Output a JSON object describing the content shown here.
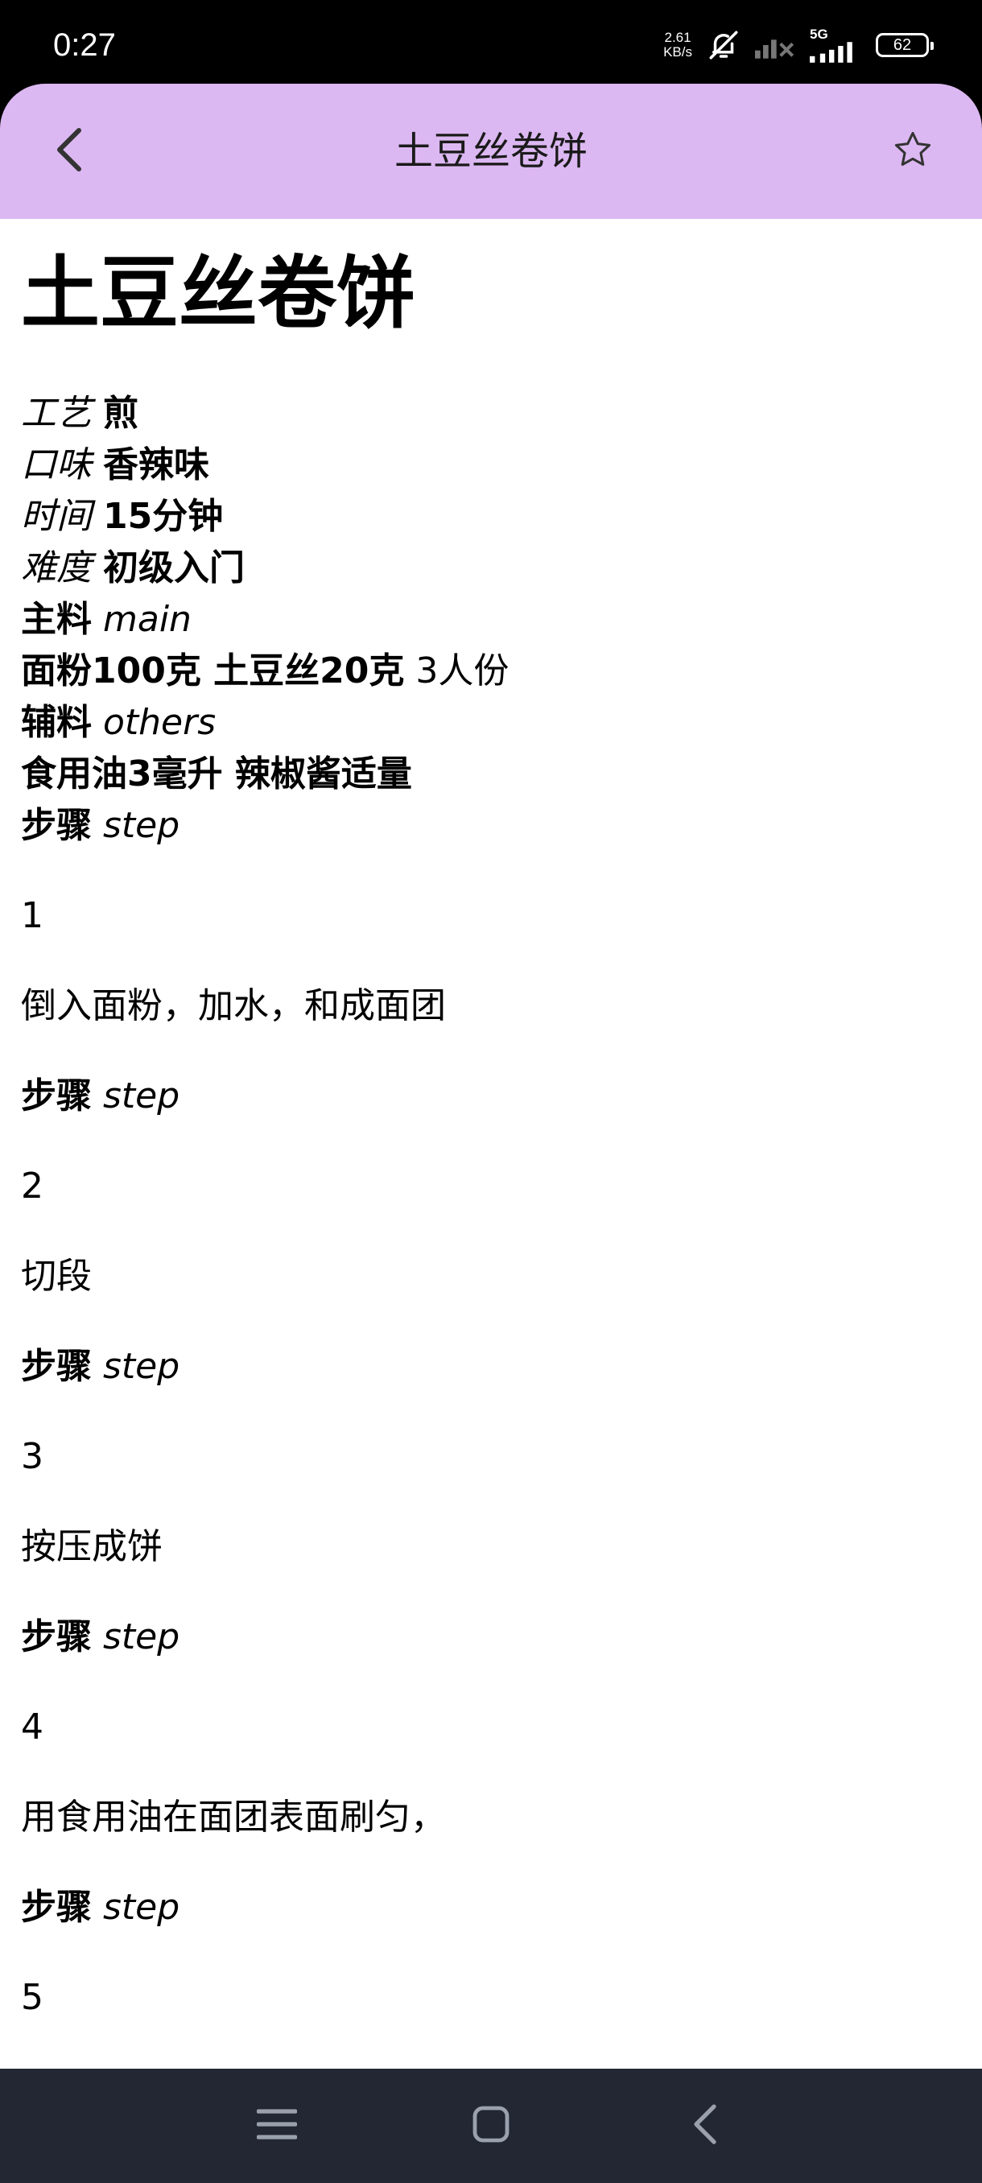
{
  "status_bar": {
    "time": "0:27",
    "net_speed_value": "2.61",
    "net_speed_unit": "KB/s",
    "network_type": "5G",
    "battery": "62"
  },
  "app_bar": {
    "title": "土豆丝卷饼"
  },
  "recipe": {
    "title": "土豆丝卷饼",
    "craft_label": "工艺",
    "craft_value": "煎",
    "taste_label": "口味",
    "taste_value": "香辣味",
    "time_label": "时间",
    "time_value": "15分钟",
    "difficulty_label": "难度",
    "difficulty_value": "初级入门",
    "main_label": "主料",
    "main_en": "main",
    "main_ingredients": "面粉100克 土豆丝20克",
    "servings": "3人份",
    "others_label": "辅料",
    "others_en": "others",
    "other_ingredients": "食用油3毫升 辣椒酱适量",
    "step_label": "步骤",
    "step_en": "step",
    "steps": [
      {
        "num": "1",
        "text": "倒入面粉，加水，和成面团"
      },
      {
        "num": "2",
        "text": "切段"
      },
      {
        "num": "3",
        "text": "按压成饼"
      },
      {
        "num": "4",
        "text": "用食用油在面团表面刷匀，"
      },
      {
        "num": "5",
        "text": ""
      }
    ]
  },
  "colors": {
    "app_bar_bg": "#dcb8f2",
    "nav_bar_bg": "#222733"
  }
}
